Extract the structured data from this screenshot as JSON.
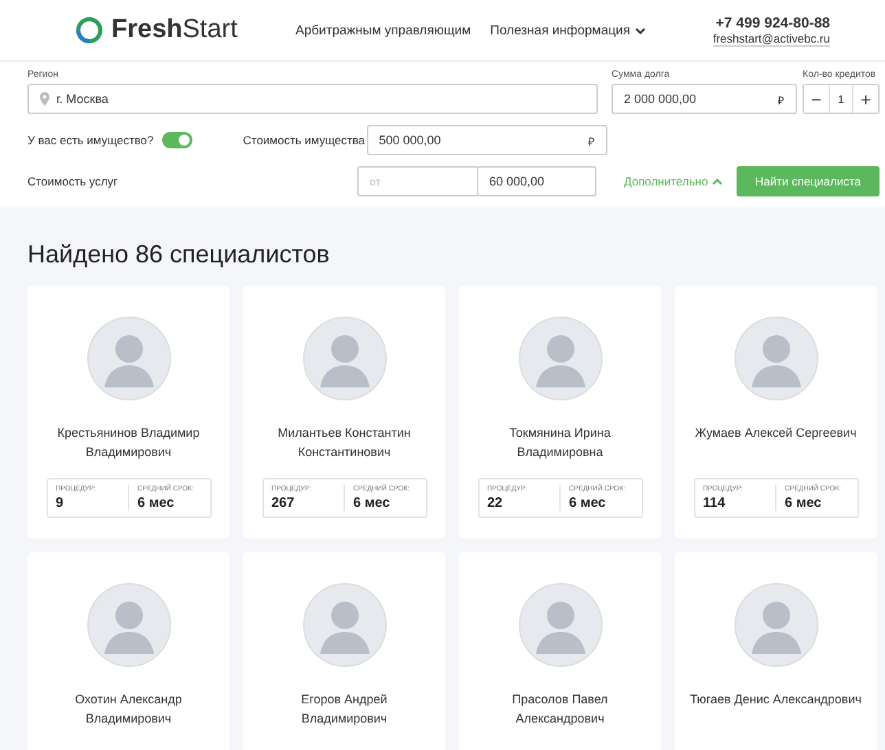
{
  "header": {
    "logo": "**Fresh**Start",
    "nav": [
      {
        "label": "Арбитражным управляющим",
        "dropdown": false
      },
      {
        "label": "Полезная информация",
        "dropdown": true
      }
    ],
    "phone": "+7 499 924-80-88",
    "email": "freshstart@activebc.ru"
  },
  "filters": {
    "region": {
      "label": "Регион",
      "value": "г. Москва"
    },
    "debt": {
      "label": "Сумма долга",
      "value": "2 000 000,00",
      "currency": "₽"
    },
    "credits": {
      "label": "Кол-во кредитов",
      "minus": "−",
      "value": "1",
      "plus": "+"
    },
    "property": {
      "label": "У вас есть имущество?",
      "on": true
    },
    "property_cost": {
      "label": "Стоимость имущества",
      "value": "500 000,00",
      "currency": "₽"
    },
    "service_cost": {
      "label": "Стоимость услуг",
      "from_placeholder": "от",
      "to_value": "60 000,00"
    },
    "more": {
      "label": "Дополнительно",
      "expanded": true
    },
    "search_button": "Найти специалиста"
  },
  "results": {
    "title": "Найдено 86 специалистов",
    "specialists": [
      {
        "name": "Крестьянинов Владимир Владимирович",
        "stats": [
          {
            "label": "ПРОЦЕДУР:",
            "value": "9"
          },
          {
            "label": "СРЕДНИЙ СРОК:",
            "value": "6 мес"
          }
        ]
      },
      {
        "name": "Милантьев Константин Константинович",
        "stats": [
          {
            "label": "ПРОЦЕДУР:",
            "value": "267"
          },
          {
            "label": "СРЕДНИЙ СРОК:",
            "value": "6 мес"
          }
        ]
      },
      {
        "name": "Токмянина Ирина Владимировна",
        "stats": [
          {
            "label": "ПРОЦЕДУР:",
            "value": "22"
          },
          {
            "label": "СРЕДНИЙ СРОК:",
            "value": "6 мес"
          }
        ]
      },
      {
        "name": "Жумаев Алексей Сергеевич",
        "stats": [
          {
            "label": "ПРОЦЕДУР:",
            "value": "114"
          },
          {
            "label": "СРЕДНИЙ СРОК:",
            "value": "6 мес"
          }
        ]
      },
      {
        "name": "Охотин Александр Владимирович"
      },
      {
        "name": "Егоров Андрей Владимирович"
      },
      {
        "name": "Прасолов Павел Александрович"
      },
      {
        "name": "Тюгаев Денис Александрович"
      }
    ]
  }
}
